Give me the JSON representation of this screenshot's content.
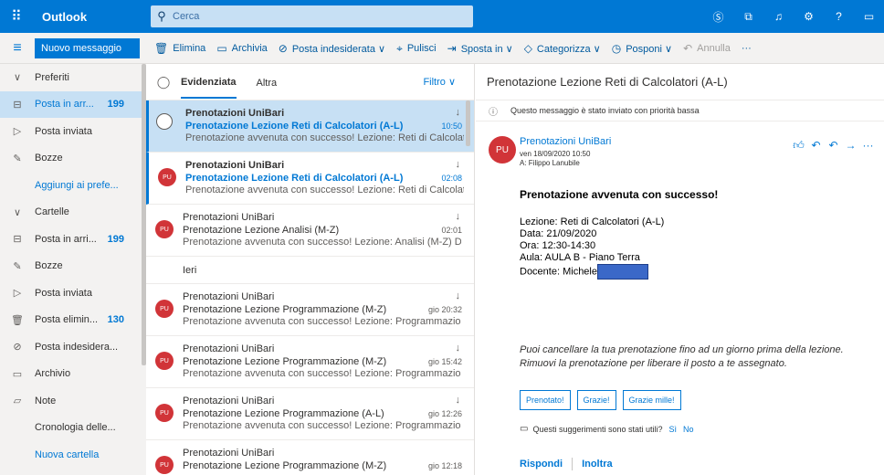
{
  "topbar": {
    "app_name": "Outlook",
    "search_placeholder": "Cerca",
    "icons": [
      "skype-icon",
      "teams-icon",
      "bell-icon",
      "gear-icon",
      "help-icon",
      "feedback-icon"
    ]
  },
  "commandbar": {
    "new_message": "Nuovo messaggio",
    "commands": [
      {
        "label": "Elimina",
        "icon": "🗑"
      },
      {
        "label": "Archivia",
        "icon": "▭"
      },
      {
        "label": "Posta indesiderata ∨",
        "icon": "⊘"
      },
      {
        "label": "Pulisci",
        "icon": "⌖"
      },
      {
        "label": "Sposta in ∨",
        "icon": "⇥"
      },
      {
        "label": "Categorizza ∨",
        "icon": "◇"
      },
      {
        "label": "Posponi ∨",
        "icon": "◷"
      },
      {
        "label": "Annulla",
        "icon": "↶"
      },
      {
        "label": "···",
        "icon": ""
      }
    ]
  },
  "leftnav": {
    "favorites_header": "Preferiti",
    "favorites": [
      {
        "label": "Posta in arr...",
        "count": "199",
        "icon": "⊟"
      },
      {
        "label": "Posta inviata",
        "count": "",
        "icon": "▷"
      },
      {
        "label": "Bozze",
        "count": "",
        "icon": "✎"
      },
      {
        "label": "Aggiungi ai prefe...",
        "count": "",
        "icon": ""
      }
    ],
    "folders_header": "Cartelle",
    "folders": [
      {
        "label": "Posta in arri...",
        "count": "199",
        "icon": "⊟"
      },
      {
        "label": "Bozze",
        "count": "",
        "icon": "✎"
      },
      {
        "label": "Posta inviata",
        "count": "",
        "icon": "▷"
      },
      {
        "label": "Posta elimin...",
        "count": "130",
        "icon": "🗑"
      },
      {
        "label": "Posta indesidera...",
        "count": "",
        "icon": "⊘"
      },
      {
        "label": "Archivio",
        "count": "",
        "icon": "▭"
      },
      {
        "label": "Note",
        "count": "",
        "icon": "▱"
      },
      {
        "label": "Cronologia delle...",
        "count": "",
        "icon": ""
      },
      {
        "label": "Nuova cartella",
        "count": "",
        "icon": ""
      }
    ]
  },
  "messagelist": {
    "tab_focused": "Evidenziata",
    "tab_other": "Altra",
    "filter": "Filtro ∨",
    "group_yesterday": "Ieri",
    "messages": [
      {
        "from": "Prenotazioni UniBari",
        "subject": "Prenotazione Lezione Reti di Calcolatori (A-L)",
        "time": "10:50",
        "preview": "Prenotazione avvenuta con successo! Lezione: Reti di Calcolatori (..."
      },
      {
        "from": "Prenotazioni UniBari",
        "subject": "Prenotazione Lezione Reti di Calcolatori (A-L)",
        "time": "02:08",
        "preview": "Prenotazione avvenuta con successo! Lezione: Reti di Calcolatori (..."
      },
      {
        "from": "Prenotazioni UniBari",
        "subject": "Prenotazione Lezione Analisi (M-Z)",
        "time": "02:01",
        "preview": "Prenotazione avvenuta con successo! Lezione: Analisi (M-Z) Data: ..."
      },
      {
        "from": "Prenotazioni UniBari",
        "subject": "Prenotazione Lezione Programmazione (M-Z)",
        "time": "gio 20:32",
        "preview": "Prenotazione avvenuta con successo! Lezione: Programmazione (..."
      },
      {
        "from": "Prenotazioni UniBari",
        "subject": "Prenotazione Lezione Programmazione (M-Z)",
        "time": "gio 15:42",
        "preview": "Prenotazione avvenuta con successo! Lezione: Programmazione (..."
      },
      {
        "from": "Prenotazioni UniBari",
        "subject": "Prenotazione Lezione Programmazione (A-L)",
        "time": "gio 12:26",
        "preview": "Prenotazione avvenuta con successo! Lezione: Programmazione (..."
      },
      {
        "from": "Prenotazioni UniBari",
        "subject": "Prenotazione Lezione Programmazione (M-Z)",
        "time": "gio 12:18",
        "preview": ""
      }
    ],
    "avatar_initials": "PU"
  },
  "reading": {
    "title": "Prenotazione Lezione Reti di Calcolatori (A-L)",
    "priority_info": "Questo messaggio è stato inviato con priorità bassa",
    "avatar": "PU",
    "from": "Prenotazioni UniBari",
    "date": "ven 18/09/2020 10:50",
    "to": "A: Filippo Lanubile",
    "headline": "Prenotazione avvenuta con successo!",
    "lines": [
      "Lezione: Reti di Calcolatori (A-L)",
      "Data: 21/09/2020",
      "Ora: 12:30-14:30",
      "Aula: AULA B - Piano Terra"
    ],
    "teacher": "Docente: Michele",
    "note_1": "Puoi cancellare la tua prenotazione fino ad un giorno prima della lezione.",
    "note_2": "Rimuovi la prenotazione per liberare il posto a te assegnato.",
    "suggestions": [
      "Prenotato!",
      "Grazie!",
      "Grazie mille!"
    ],
    "feedback_q": "Questi suggerimenti sono stati utili?",
    "feedback_yes": "Sì",
    "feedback_no": "No",
    "reply": "Rispondi",
    "forward": "Inoltra"
  },
  "colors": {
    "accent": "#0078d4",
    "avatar": "#d13438",
    "selected": "#c7e0f4"
  }
}
